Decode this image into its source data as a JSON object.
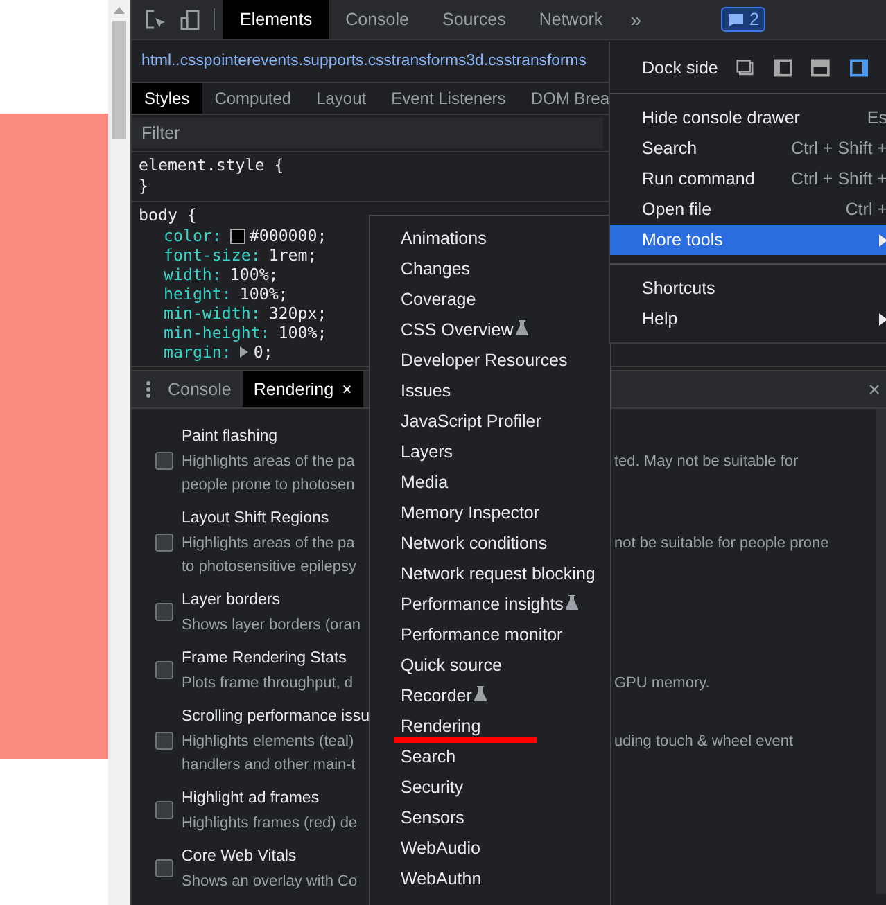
{
  "toolbar": {
    "tabs": [
      {
        "label": "Elements",
        "selected": true
      },
      {
        "label": "Console",
        "selected": false
      },
      {
        "label": "Sources",
        "selected": false
      },
      {
        "label": "Network",
        "selected": false
      }
    ],
    "overflow": "»",
    "issues_count": "2"
  },
  "breadcrumb": "html..csspointerevents.supports.csstransforms3d.csstransforms",
  "styles_tabs": [
    {
      "label": "Styles",
      "selected": true
    },
    {
      "label": "Computed",
      "selected": false
    },
    {
      "label": "Layout",
      "selected": false
    },
    {
      "label": "Event Listeners",
      "selected": false
    },
    {
      "label": "DOM Brea",
      "selected": false
    }
  ],
  "filter": {
    "placeholder": "Filter"
  },
  "rules": [
    {
      "selector": "element.style {",
      "close": "}"
    },
    {
      "selector": "body {",
      "declarations": [
        {
          "kind": "color",
          "property": "color:",
          "value": "#000000;"
        },
        {
          "kind": "plain",
          "property": "font-size:",
          "value": "1rem;"
        },
        {
          "kind": "plain",
          "property": "width:",
          "value": "100%;"
        },
        {
          "kind": "plain",
          "property": "height:",
          "value": "100%;"
        },
        {
          "kind": "plain",
          "property": "min-width:",
          "value": "320px;"
        },
        {
          "kind": "plain",
          "property": "min-height:",
          "value": "100%;"
        },
        {
          "kind": "shorthand",
          "property": "margin:",
          "value": "0;"
        }
      ]
    }
  ],
  "drawer": {
    "tabs": [
      {
        "label": "Console",
        "selected": false,
        "closable": false
      },
      {
        "label": "Rendering",
        "selected": true,
        "closable": true,
        "close": "×"
      }
    ],
    "close": "×"
  },
  "rendering_options": [
    {
      "title": "Paint flashing",
      "checked": false,
      "lines": [
        {
          "left": "Highlights areas of the pa",
          "right": "ted. May not be suitable for"
        },
        {
          "left": "people prone to photosen"
        }
      ]
    },
    {
      "title": "Layout Shift Regions",
      "checked": false,
      "lines": [
        {
          "left": "Highlights areas of the pa",
          "right": "not be suitable for people prone"
        },
        {
          "left": "to photosensitive epilepsy"
        }
      ]
    },
    {
      "title": "Layer borders",
      "checked": false,
      "lines": [
        {
          "left": "Shows layer borders (oran"
        }
      ]
    },
    {
      "title": "Frame Rendering Stats",
      "checked": false,
      "lines": [
        {
          "left": "Plots frame throughput, d",
          "right": "GPU memory."
        }
      ]
    },
    {
      "title": "Scrolling performance issu",
      "checked": false,
      "lines": [
        {
          "left": "Highlights elements (teal)",
          "right": "uding touch & wheel event"
        },
        {
          "left": "handlers and other main-t"
        }
      ]
    },
    {
      "title": "Highlight ad frames",
      "checked": false,
      "lines": [
        {
          "left": "Highlights frames (red) de"
        }
      ]
    },
    {
      "title": "Core Web Vitals",
      "checked": false,
      "lines": [
        {
          "left": "Shows an overlay with Co"
        }
      ]
    }
  ],
  "main_menu": {
    "dock_label": "Dock side",
    "dock_options": [
      {
        "selected": false
      },
      {
        "selected": false
      },
      {
        "selected": false
      },
      {
        "selected": true
      }
    ],
    "items": [
      {
        "kind": "separator"
      },
      {
        "kind": "item",
        "label": "Hide console drawer",
        "shortcut": "Es",
        "highlighted": false,
        "submenu": false
      },
      {
        "kind": "item",
        "label": "Search",
        "shortcut": "Ctrl + Shift +",
        "highlighted": false,
        "submenu": false
      },
      {
        "kind": "item",
        "label": "Run command",
        "shortcut": "Ctrl + Shift +",
        "highlighted": false,
        "submenu": false
      },
      {
        "kind": "item",
        "label": "Open file",
        "shortcut": "Ctrl +",
        "highlighted": false,
        "submenu": false
      },
      {
        "kind": "item",
        "label": "More tools",
        "highlighted": true,
        "submenu": true
      },
      {
        "kind": "separator"
      },
      {
        "kind": "item",
        "label": "Shortcuts",
        "highlighted": false,
        "submenu": false
      },
      {
        "kind": "item",
        "label": "Help",
        "highlighted": false,
        "submenu": true
      }
    ]
  },
  "more_tools_menu": [
    {
      "label": "Animations",
      "experimental": false,
      "marked": false
    },
    {
      "label": "Changes",
      "experimental": false,
      "marked": false
    },
    {
      "label": "Coverage",
      "experimental": false,
      "marked": false
    },
    {
      "label": "CSS Overview",
      "experimental": true,
      "marked": false
    },
    {
      "label": "Developer Resources",
      "experimental": false,
      "marked": false
    },
    {
      "label": "Issues",
      "experimental": false,
      "marked": false
    },
    {
      "label": "JavaScript Profiler",
      "experimental": false,
      "marked": false
    },
    {
      "label": "Layers",
      "experimental": false,
      "marked": false
    },
    {
      "label": "Media",
      "experimental": false,
      "marked": false
    },
    {
      "label": "Memory Inspector",
      "experimental": false,
      "marked": false
    },
    {
      "label": "Network conditions",
      "experimental": false,
      "marked": false
    },
    {
      "label": "Network request blocking",
      "experimental": false,
      "marked": false
    },
    {
      "label": "Performance insights",
      "experimental": true,
      "marked": false
    },
    {
      "label": "Performance monitor",
      "experimental": false,
      "marked": false
    },
    {
      "label": "Quick source",
      "experimental": false,
      "marked": false
    },
    {
      "label": "Recorder",
      "experimental": true,
      "marked": false
    },
    {
      "label": "Rendering",
      "experimental": false,
      "marked": true
    },
    {
      "label": "Search",
      "experimental": false,
      "marked": false
    },
    {
      "label": "Security",
      "experimental": false,
      "marked": false
    },
    {
      "label": "Sensors",
      "experimental": false,
      "marked": false
    },
    {
      "label": "WebAudio",
      "experimental": false,
      "marked": false
    },
    {
      "label": "WebAuthn",
      "experimental": false,
      "marked": false
    }
  ]
}
